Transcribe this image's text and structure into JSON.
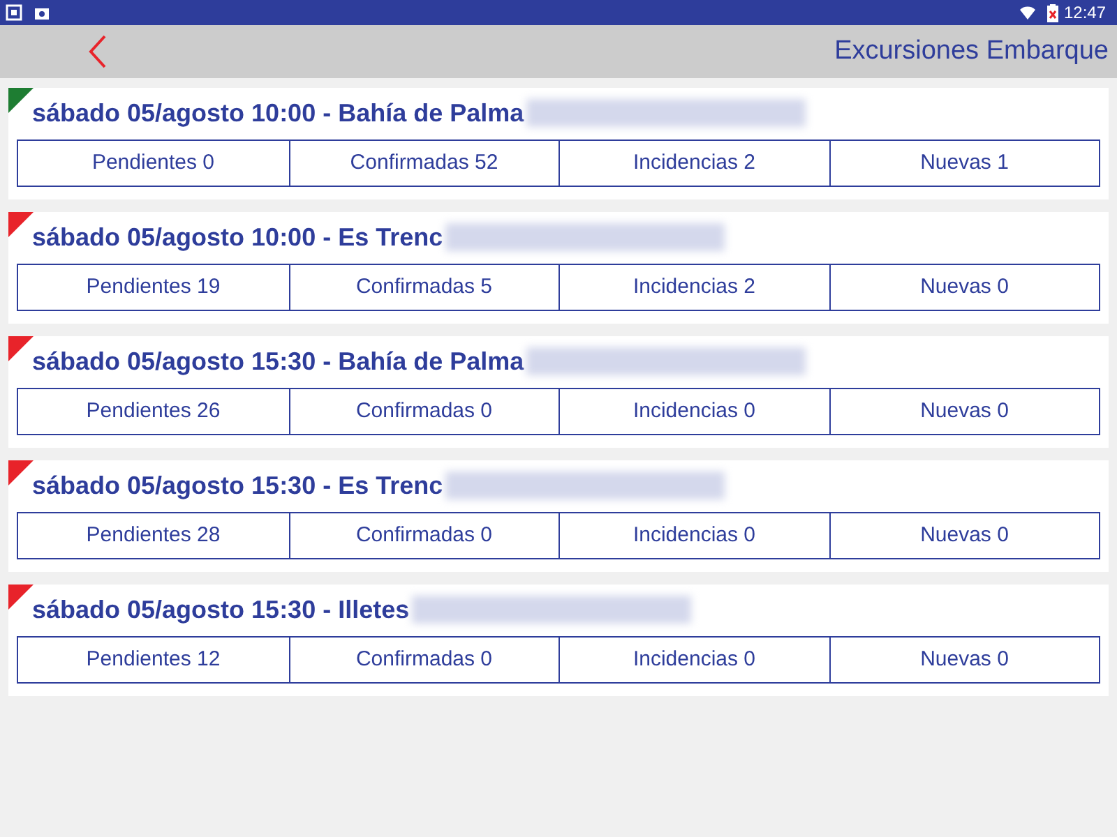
{
  "status_bar": {
    "time": "12:47"
  },
  "toolbar": {
    "title": "Excursiones Embarque"
  },
  "excursions": [
    {
      "title": "sábado 05/agosto 10:00 - Bahía de Palma",
      "color": "#1e7d32",
      "counts": [
        "Pendientes 0",
        "Confirmadas 52",
        "Incidencias 2",
        "Nuevas 1"
      ]
    },
    {
      "title": "sábado 05/agosto 10:00 - Es Trenc",
      "color": "#e8232a",
      "counts": [
        "Pendientes 19",
        "Confirmadas 5",
        "Incidencias 2",
        "Nuevas 0"
      ]
    },
    {
      "title": "sábado 05/agosto 15:30 - Bahía de Palma",
      "color": "#e8232a",
      "counts": [
        "Pendientes 26",
        "Confirmadas 0",
        "Incidencias 0",
        "Nuevas 0"
      ]
    },
    {
      "title": "sábado 05/agosto 15:30 - Es Trenc",
      "color": "#e8232a",
      "counts": [
        "Pendientes 28",
        "Confirmadas 0",
        "Incidencias 0",
        "Nuevas 0"
      ]
    },
    {
      "title": "sábado 05/agosto 15:30 - Illetes",
      "color": "#e8232a",
      "counts": [
        "Pendientes 12",
        "Confirmadas 0",
        "Incidencias 0",
        "Nuevas 0"
      ]
    }
  ]
}
